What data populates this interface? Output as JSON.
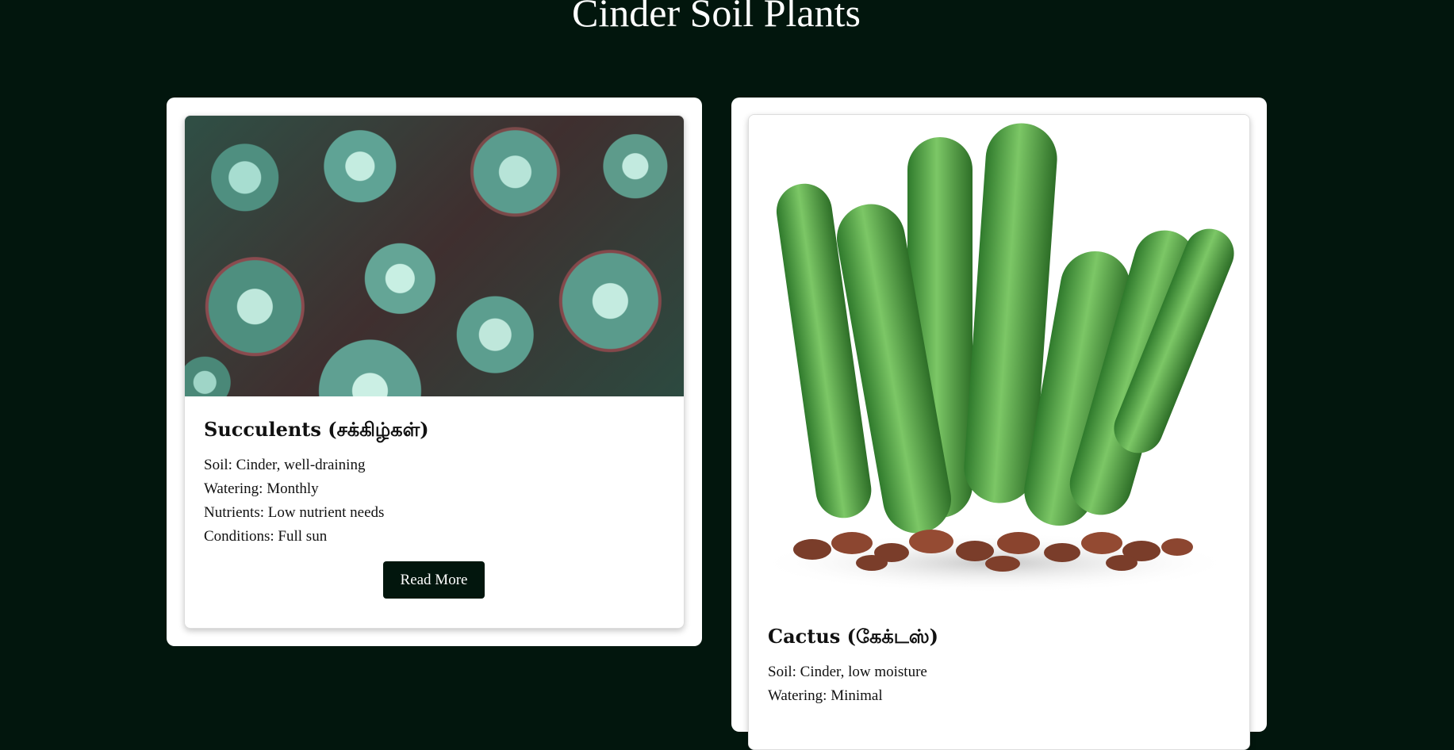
{
  "page": {
    "title": "Cinder Soil Plants"
  },
  "cards": [
    {
      "title": "Succulents (சக்கிழ்கள்)",
      "details": [
        "Soil: Cinder, well-draining",
        "Watering: Monthly",
        "Nutrients: Low nutrient needs",
        "Conditions: Full sun"
      ],
      "button": "Read More"
    },
    {
      "title": "Cactus (கேக்டஸ்)",
      "details": [
        "Soil: Cinder, low moisture",
        "Watering: Minimal"
      ]
    }
  ],
  "colors": {
    "background": "#02160d",
    "card": "#ffffff",
    "button": "#02160d"
  }
}
